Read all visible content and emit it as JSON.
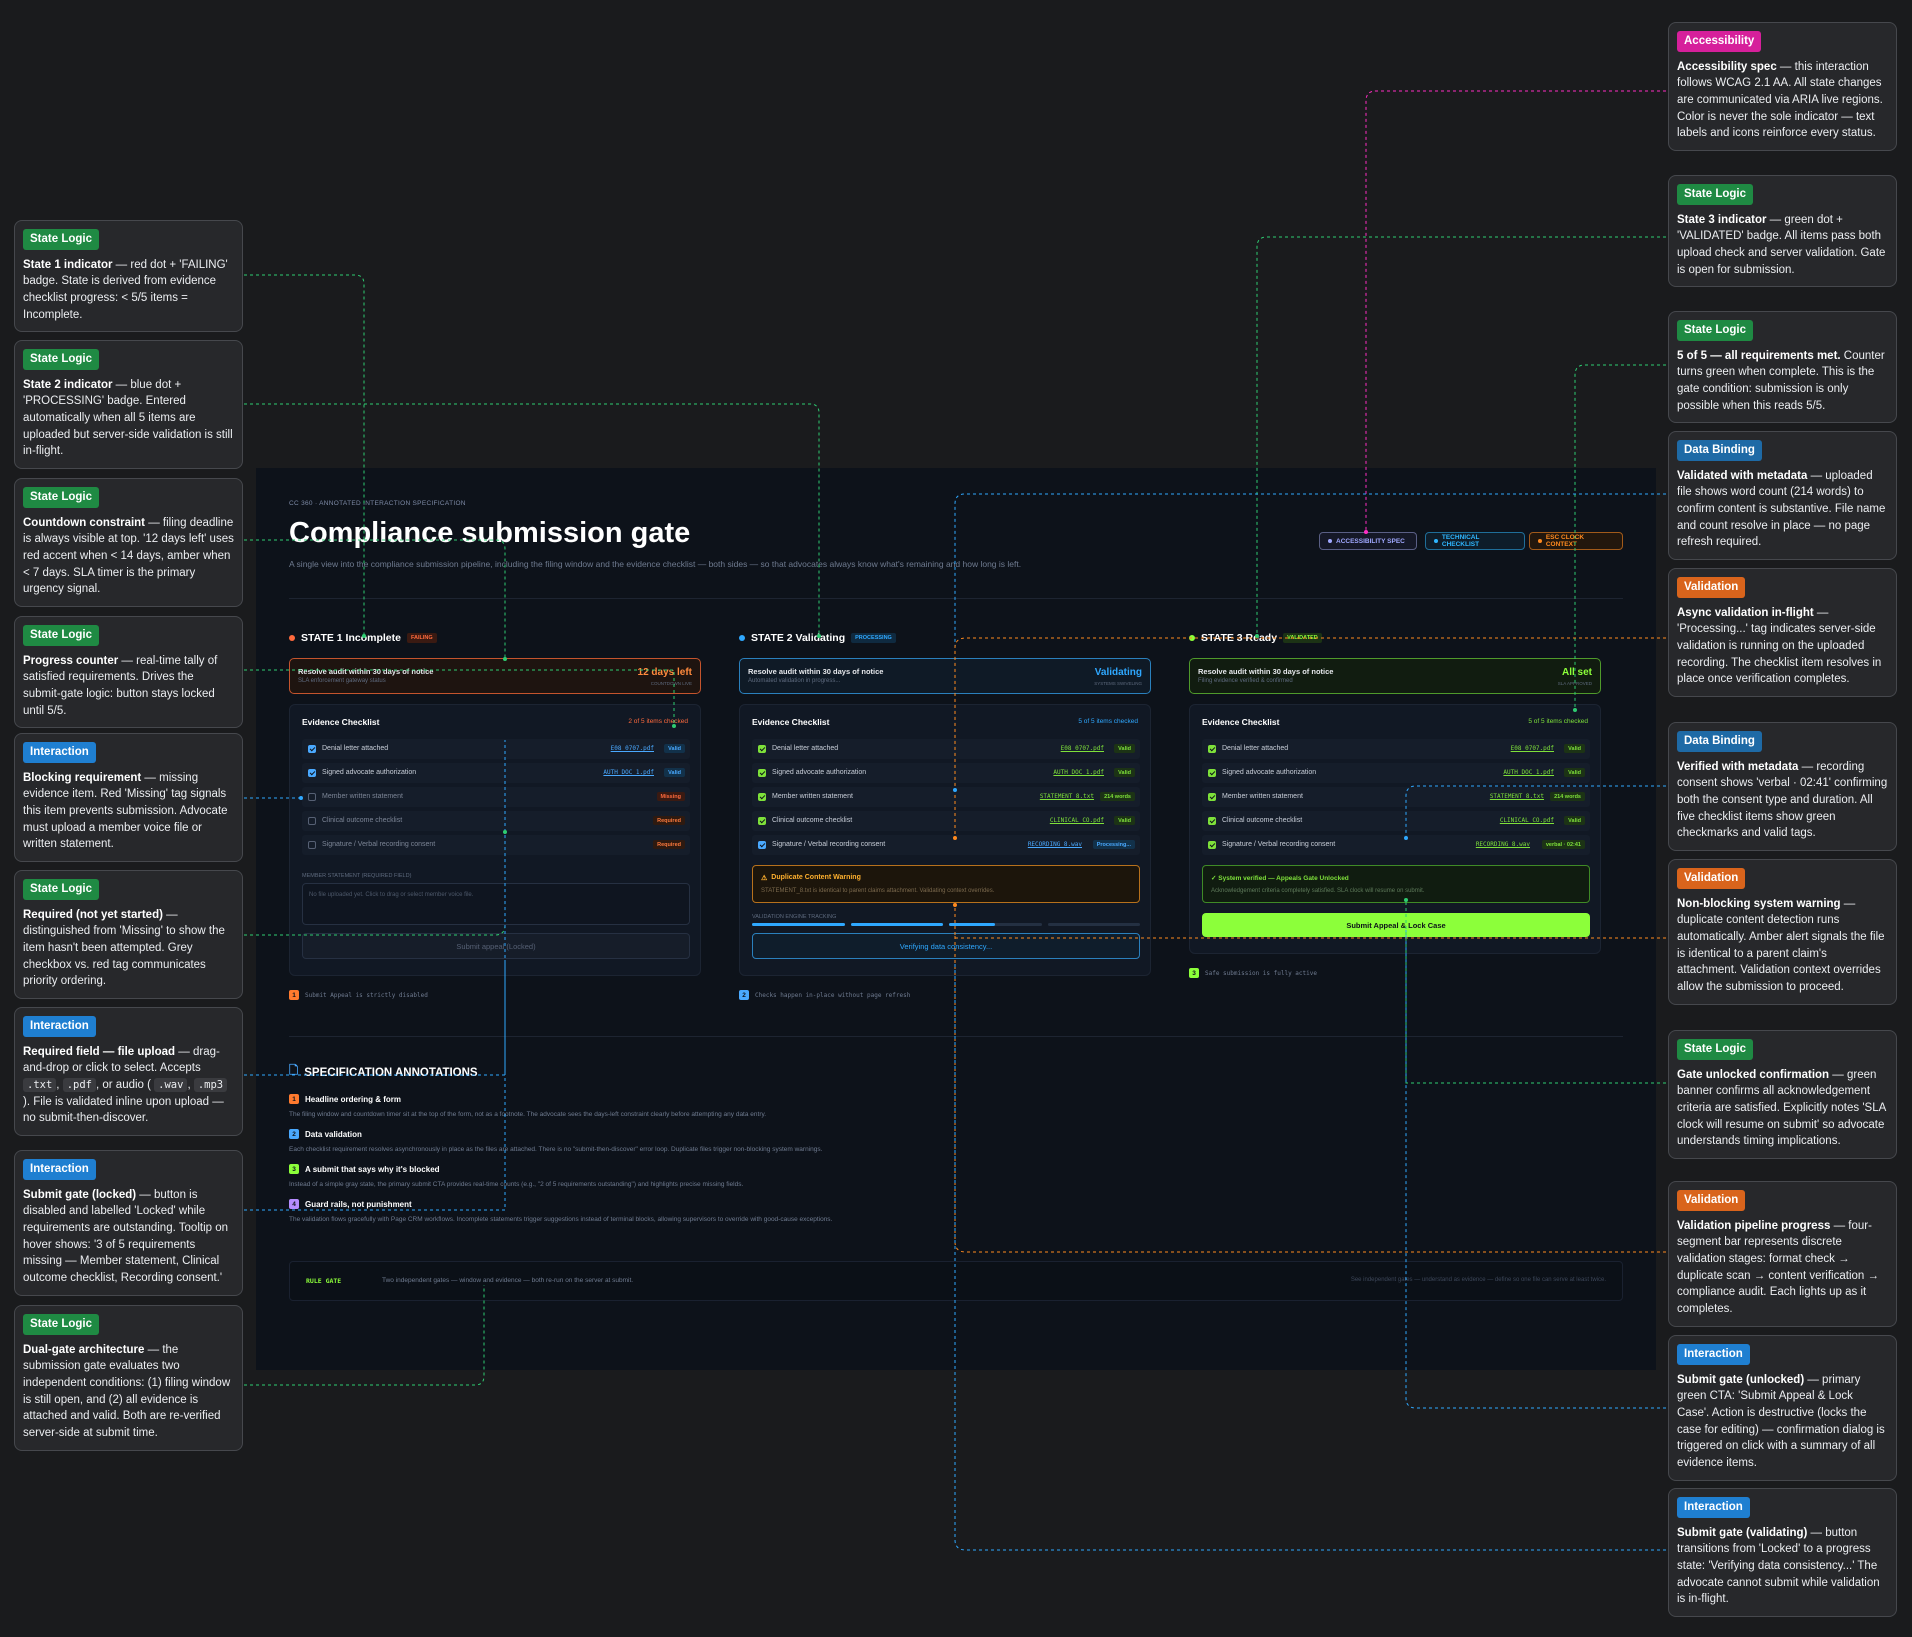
{
  "frame": {
    "eyebrow": "CC 360 · ANNOTATED INTERACTION SPECIFICATION",
    "title": "Compliance submission gate",
    "subtitle": "A single view into the compliance submission pipeline, including the filing window and the evidence checklist — both sides — so that advocates always know what's remaining and how long is left.",
    "pills": [
      {
        "label": "ACCESSIBILITY SPEC",
        "color": "#a0a8ff"
      },
      {
        "label": "TECHNICAL CHECKLIST",
        "color": "#2fb6ff"
      },
      {
        "label": "ESC CLOCK CONTEXT",
        "color": "#ff8a1f"
      }
    ],
    "states": [
      {
        "title": "STATE 1 Incomplete",
        "badge": "FAILING",
        "deadline": {
          "title": "Resolve audit within 30 days of notice",
          "sub": "SLA enforcement gateway status",
          "value": "12 days left",
          "value_sub": "COUNTDOWN LIVE"
        },
        "checklist_title": "Evidence Checklist",
        "count": "2 of 5 items checked",
        "items": [
          {
            "label": "Denial letter attached",
            "file": "E08_0707.pdf",
            "tag": "Valid",
            "checked": true
          },
          {
            "label": "Signed advocate authorization",
            "file": "AUTH_DOC_1.pdf",
            "tag": "Valid",
            "checked": true
          },
          {
            "label": "Member written statement",
            "file": "",
            "tag": "Missing",
            "checked": false
          },
          {
            "label": "Clinical outcome checklist",
            "file": "",
            "tag": "Required",
            "checked": false
          },
          {
            "label": "Signature / Verbal recording consent",
            "file": "",
            "tag": "Required",
            "checked": false
          }
        ],
        "upload_label": "MEMBER STATEMENT (REQUIRED FIELD)",
        "upload_placeholder": "No file uploaded yet. Click to drag or select member voice file.",
        "button": "Submit appeal (Locked)",
        "footnote": "Submit Appeal is strictly disabled"
      },
      {
        "title": "STATE 2 Validating",
        "badge": "PROCESSING",
        "deadline": {
          "title": "Resolve audit within 30 days of notice",
          "sub": "Automated validation in progress...",
          "value": "Validating",
          "value_sub": "SYSTEMS SWIVELING"
        },
        "checklist_title": "Evidence Checklist",
        "count": "5 of 5 items checked",
        "items": [
          {
            "label": "Denial letter attached",
            "file": "E08_0707.pdf",
            "tag": "Valid",
            "checked": true
          },
          {
            "label": "Signed advocate authorization",
            "file": "AUTH_DOC_1.pdf",
            "tag": "Valid",
            "checked": true
          },
          {
            "label": "Member written statement",
            "file": "STATEMENT_8.txt",
            "tag": "214 words",
            "checked": true
          },
          {
            "label": "Clinical outcome checklist",
            "file": "CLINICAL_CO.pdf",
            "tag": "Valid",
            "checked": true
          },
          {
            "label": "Signature / Verbal recording consent",
            "file": "RECORDING_8.wav",
            "tag": "Processing...",
            "checked": true
          }
        ],
        "warning_title": "Duplicate Content Warning",
        "warning_text": "STATEMENT_8.txt is identical to parent claims attachment. Validating context overrides.",
        "engine_label": "VALIDATION ENGINE TRACKING",
        "progress_segments": 4,
        "progress_complete": 2.5,
        "button": "Verifying data consistency...",
        "footnote": "Checks happen in-place without page refresh"
      },
      {
        "title": "STATE 3 Ready",
        "badge": "VALIDATED",
        "deadline": {
          "title": "Resolve audit within 30 days of notice",
          "sub": "Filing evidence verified & confirmed",
          "value": "All set",
          "value_sub": "SLA APPROVED"
        },
        "checklist_title": "Evidence Checklist",
        "count": "5 of 5 items checked",
        "items": [
          {
            "label": "Denial letter attached",
            "file": "E08_0707.pdf",
            "tag": "Valid",
            "checked": true
          },
          {
            "label": "Signed advocate authorization",
            "file": "AUTH_DOC_1.pdf",
            "tag": "Valid",
            "checked": true
          },
          {
            "label": "Member written statement",
            "file": "STATEMENT_8.txt",
            "tag": "214 words",
            "checked": true
          },
          {
            "label": "Clinical outcome checklist",
            "file": "CLINICAL_CO.pdf",
            "tag": "Valid",
            "checked": true
          },
          {
            "label": "Signature / Verbal recording consent",
            "file": "RECORDING_8.wav",
            "tag": "verbal · 02:41",
            "checked": true
          }
        ],
        "verified_title": "✓ System verified — Appeals Gate Unlocked",
        "verified_text": "Acknowledgement criteria completely satisfied. SLA clock will resume on submit.",
        "button": "Submit Appeal & Lock Case",
        "footnote": "Safe submission is fully active"
      }
    ],
    "spec_title": "SPECIFICATION ANNOTATIONS",
    "spec_items": [
      {
        "num": "1",
        "title": "Headline ordering & form",
        "text": "The filing window and countdown timer sit at the top of the form, not as a footnote. The advocate sees the days-left constraint clearly before attempting any data entry."
      },
      {
        "num": "2",
        "title": "Data validation",
        "text": "Each checklist requirement resolves asynchronously in place as the files are attached. There is no \"submit-then-discover\" error loop. Duplicate files trigger non-blocking system warnings."
      },
      {
        "num": "3",
        "title": "A submit that says why it's blocked",
        "text": "Instead of a simple gray state, the primary submit CTA provides real-time counts (e.g., \"2 of 5 requirements outstanding\") and highlights precise missing fields."
      },
      {
        "num": "4",
        "title": "Guard rails, not punishment",
        "text": "The validation flows gracefully with Page CRM workflows. Incomplete statements trigger suggestions instead of terminal blocks, allowing supervisors to override with good-cause exceptions."
      }
    ],
    "rule": {
      "label": "RULE GATE",
      "text": "Two independent gates — window and evidence — both re-run on the server at submit.",
      "right": "See independent gates — understand as evidence — define so one file can serve at least twice."
    }
  },
  "left_annotations": [
    {
      "tag": "State Logic",
      "bold": "State 1 indicator",
      "text": " — red dot + 'FAILING' badge. State is derived from evidence checklist progress: < 5/5 items = Incomplete."
    },
    {
      "tag": "State Logic",
      "bold": "State 2 indicator",
      "text": " — blue dot + 'PROCESSING' badge. Entered automatically when all 5 items are uploaded but server-side validation is still in-flight."
    },
    {
      "tag": "State Logic",
      "bold": "Countdown constraint",
      "text": " — filing deadline is always visible at top. '12 days left' uses red accent when < 14 days, amber when < 7 days. SLA timer is the primary urgency signal."
    },
    {
      "tag": "State Logic",
      "bold": "Progress counter",
      "text": " — real-time tally of satisfied requirements. Drives the submit-gate logic: button stays locked until 5/5."
    },
    {
      "tag": "Interaction",
      "bold": "Blocking requirement",
      "text": " — missing evidence item. Red 'Missing' tag signals this item prevents submission. Advocate must upload a member voice file or written statement."
    },
    {
      "tag": "State Logic",
      "bold": "Required (not yet started)",
      "text": " — distinguished from 'Missing' to show the item hasn't been attempted. Grey checkbox vs. red tag communicates priority ordering."
    },
    {
      "tag": "Interaction",
      "bold": "Required field — file upload",
      "text": " — drag-and-drop or click to select. Accepts",
      "code1": ".txt",
      "sep1": ", ",
      "code2": ".pdf",
      "sep2": ", or audio ( ",
      "code3": ".wav",
      "sep3": ", ",
      "code4": ".mp3",
      "text2": " ). File is validated inline upon upload — no submit-then-discover."
    },
    {
      "tag": "Interaction",
      "bold": "Submit gate (locked)",
      "text": " — button is disabled and labelled 'Locked' while requirements are outstanding. Tooltip on hover shows: '3 of 5 requirements missing — Member statement, Clinical outcome checklist, Recording consent.'"
    },
    {
      "tag": "State Logic",
      "bold": "Dual-gate architecture",
      "text": " — the submission gate evaluates two independent conditions: (1) filing window is still open, and (2) all evidence is attached and valid. Both are re-verified server-side at submit time."
    }
  ],
  "right_annotations": [
    {
      "tag": "Accessibility",
      "bold": "Accessibility spec",
      "text": " — this interaction follows WCAG 2.1 AA. All state changes are communicated via ARIA live regions. Color is never the sole indicator — text labels and icons reinforce every status."
    },
    {
      "tag": "State Logic",
      "bold": "State 3 indicator",
      "text": " — green dot + 'VALIDATED' badge. All items pass both upload check and server validation. Gate is open for submission."
    },
    {
      "tag": "State Logic",
      "bold": "5 of 5 — all requirements met.",
      "text": " Counter turns green when complete. This is the gate condition: submission is only possible when this reads 5/5."
    },
    {
      "tag": "Data Binding",
      "bold": "Validated with metadata",
      "text": " — uploaded file shows word count (214 words) to confirm content is substantive. File name and count resolve in place — no page refresh required."
    },
    {
      "tag": "Validation",
      "bold": "Async validation in-flight",
      "text": " — 'Processing...' tag indicates server-side validation is running on the uploaded recording. The checklist item resolves in place once verification completes."
    },
    {
      "tag": "Data Binding",
      "bold": "Verified with metadata",
      "text": " — recording consent shows 'verbal · 02:41' confirming both the consent type and duration. All five checklist items show green checkmarks and valid tags."
    },
    {
      "tag": "Validation",
      "bold": "Non-blocking system warning",
      "text": " — duplicate content detection runs automatically. Amber alert signals the file is identical to a parent claim's attachment. Validation context overrides allow the submission to proceed."
    },
    {
      "tag": "State Logic",
      "bold": "Gate unlocked confirmation",
      "text": " — green banner confirms all acknowledgement criteria are satisfied. Explicitly notes 'SLA clock will resume on submit' so advocate understands timing implications."
    },
    {
      "tag": "Validation",
      "bold": "Validation pipeline progress",
      "text": " — four-segment bar represents discrete validation stages: format check → duplicate scan → content verification → compliance audit. Each lights up as it completes."
    },
    {
      "tag": "Interaction",
      "bold": "Submit gate (unlocked)",
      "text": " — primary green CTA: 'Submit Appeal & Lock Case'. Action is destructive (locks the case for editing) — confirmation dialog is triggered on click with a summary of all evidence items."
    },
    {
      "tag": "Interaction",
      "bold": "Submit gate (validating)",
      "text": " — button transitions from 'Locked' to a progress state: 'Verifying data consistency...' The advocate cannot submit while validation is in-flight."
    }
  ],
  "colors": {
    "red": "#ff6a3d",
    "blue": "#2fa8ff",
    "green": "#8cff3a",
    "amber": "#ffb02e",
    "check_blue": "#4aa9ff",
    "check_green": "#7ee13a"
  }
}
